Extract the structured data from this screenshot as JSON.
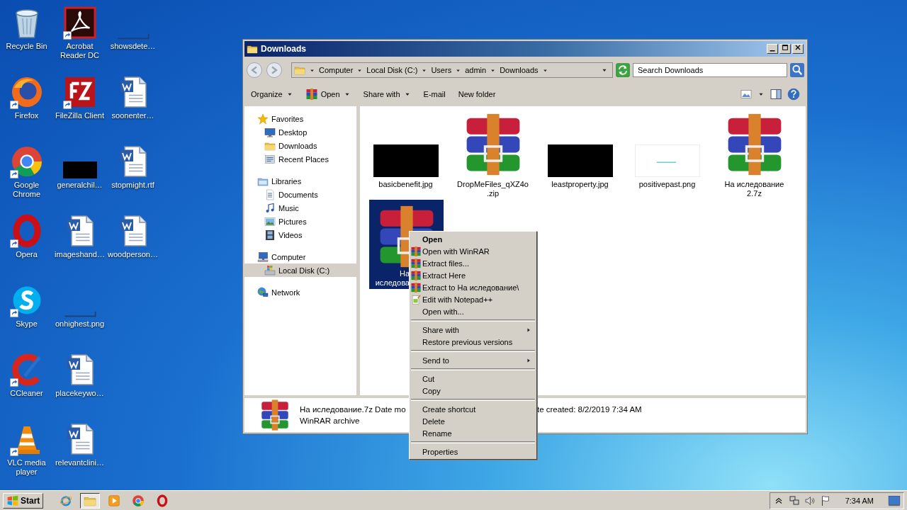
{
  "desktop_icons": [
    {
      "label": "Recycle Bin",
      "kind": "recycle",
      "shortcut": false
    },
    {
      "label": "Firefox",
      "kind": "firefox",
      "shortcut": true
    },
    {
      "label": "Google Chrome",
      "kind": "chrome",
      "shortcut": true
    },
    {
      "label": "Opera",
      "kind": "opera",
      "shortcut": true
    },
    {
      "label": "Skype",
      "kind": "skype",
      "shortcut": true
    },
    {
      "label": "CCleaner",
      "kind": "ccleaner",
      "shortcut": true
    },
    {
      "label": "VLC media player",
      "kind": "vlc",
      "shortcut": true
    },
    {
      "label": "Acrobat Reader DC",
      "kind": "acrobat",
      "shortcut": true
    },
    {
      "label": "FileZilla Client",
      "kind": "filezilla",
      "shortcut": true
    },
    {
      "label": "generalchil…",
      "kind": "dark",
      "shortcut": false
    },
    {
      "label": "imageshand…",
      "kind": "word",
      "shortcut": false
    },
    {
      "label": "onhighest.png",
      "kind": "blank",
      "shortcut": false
    },
    {
      "label": "placekeywo…",
      "kind": "word",
      "shortcut": false
    },
    {
      "label": "relevantclini…",
      "kind": "word",
      "shortcut": false
    },
    {
      "label": "showsdete…",
      "kind": "blank",
      "shortcut": false
    },
    {
      "label": "soonenter…",
      "kind": "word",
      "shortcut": false
    },
    {
      "label": "stopmight.rtf",
      "kind": "word",
      "shortcut": false
    },
    {
      "label": "woodperson…",
      "kind": "word",
      "shortcut": false
    }
  ],
  "window": {
    "title": "Downloads",
    "address": [
      "Computer",
      "Local Disk (C:)",
      "Users",
      "admin",
      "Downloads"
    ],
    "search": {
      "placeholder": "Search Downloads"
    },
    "toolbar": [
      {
        "label": "Organize",
        "dropdown": true,
        "kind": "plain"
      },
      {
        "label": "Open",
        "dropdown": true,
        "kind": "winrar"
      },
      {
        "label": "Share with",
        "dropdown": true,
        "kind": "plain"
      },
      {
        "label": "E-mail",
        "dropdown": false,
        "kind": "plain"
      },
      {
        "label": "New folder",
        "dropdown": false,
        "kind": "plain"
      }
    ],
    "nav": [
      {
        "label": "Favorites",
        "kind": "star",
        "selected": false,
        "children": [
          {
            "label": "Desktop",
            "kind": "monitor",
            "selected": false
          },
          {
            "label": "Downloads",
            "kind": "folder",
            "selected": false
          },
          {
            "label": "Recent Places",
            "kind": "recent",
            "selected": false
          }
        ]
      },
      {
        "label": "Libraries",
        "kind": "library",
        "selected": false,
        "children": [
          {
            "label": "Documents",
            "kind": "document",
            "selected": false
          },
          {
            "label": "Music",
            "kind": "music",
            "selected": false
          },
          {
            "label": "Pictures",
            "kind": "pictures",
            "selected": false
          },
          {
            "label": "Videos",
            "kind": "video",
            "selected": false
          }
        ]
      },
      {
        "label": "Computer",
        "kind": "computer",
        "selected": false,
        "children": [
          {
            "label": "Local Disk (C:)",
            "kind": "disk",
            "selected": true
          }
        ]
      },
      {
        "label": "Network",
        "kind": "network",
        "selected": false
      }
    ],
    "files": [
      {
        "lines": [
          "basicbenefit.jpg"
        ],
        "kind": "dark",
        "selected": false
      },
      {
        "lines": [
          "DropMeFiles_qXZ4o",
          ".zip"
        ],
        "kind": "archive",
        "selected": false
      },
      {
        "lines": [
          "leastproperty.jpg"
        ],
        "kind": "dark",
        "selected": false
      },
      {
        "lines": [
          "positivepast.png"
        ],
        "kind": "light",
        "selected": false
      },
      {
        "lines": [
          "На иследование",
          "2.7z"
        ],
        "kind": "archive",
        "selected": false
      },
      {
        "lines": [
          "На",
          "иследова"
        ],
        "kind": "archive",
        "selected": true
      }
    ],
    "details": {
      "name": "На иследование.7z Date mo",
      "rest": "te created: 8/2/2019 7:34 AM",
      "type": "WinRAR archive"
    }
  },
  "context_menu": [
    {
      "kind": "plain",
      "label": "Open",
      "bold": true,
      "submenu": false
    },
    {
      "kind": "winrar",
      "label": "Open with WinRAR",
      "bold": false,
      "submenu": false
    },
    {
      "kind": "winrar",
      "label": "Extract files...",
      "bold": false,
      "submenu": false
    },
    {
      "kind": "winrar",
      "label": "Extract Here",
      "bold": false,
      "submenu": false
    },
    {
      "kind": "winrar",
      "label": "Extract to На иследование\\",
      "bold": false,
      "submenu": false
    },
    {
      "kind": "notepad",
      "label": "Edit with Notepad++",
      "bold": false,
      "submenu": false
    },
    {
      "kind": "plain",
      "label": "Open with...",
      "bold": false,
      "submenu": false
    },
    {
      "kind": "separator"
    },
    {
      "kind": "plain",
      "label": "Share with",
      "bold": false,
      "submenu": true
    },
    {
      "kind": "plain",
      "label": "Restore previous versions",
      "bold": false,
      "submenu": false
    },
    {
      "kind": "separator"
    },
    {
      "kind": "plain",
      "label": "Send to",
      "bold": false,
      "submenu": true
    },
    {
      "kind": "separator"
    },
    {
      "kind": "plain",
      "label": "Cut",
      "bold": false,
      "submenu": false
    },
    {
      "kind": "plain",
      "label": "Copy",
      "bold": false,
      "submenu": false
    },
    {
      "kind": "separator"
    },
    {
      "kind": "plain",
      "label": "Create shortcut",
      "bold": false,
      "submenu": false
    },
    {
      "kind": "plain",
      "label": "Delete",
      "bold": false,
      "submenu": false
    },
    {
      "kind": "plain",
      "label": "Rename",
      "bold": false,
      "submenu": false
    },
    {
      "kind": "separator"
    },
    {
      "kind": "plain",
      "label": "Properties",
      "bold": false,
      "submenu": false
    }
  ],
  "taskbar": {
    "start": "Start",
    "apps": [
      {
        "kind": "ie",
        "active": false
      },
      {
        "kind": "folder",
        "active": true
      },
      {
        "kind": "media",
        "active": false
      },
      {
        "kind": "chrome",
        "active": false
      },
      {
        "kind": "opera",
        "active": false
      }
    ],
    "time": "7:34 AM"
  }
}
